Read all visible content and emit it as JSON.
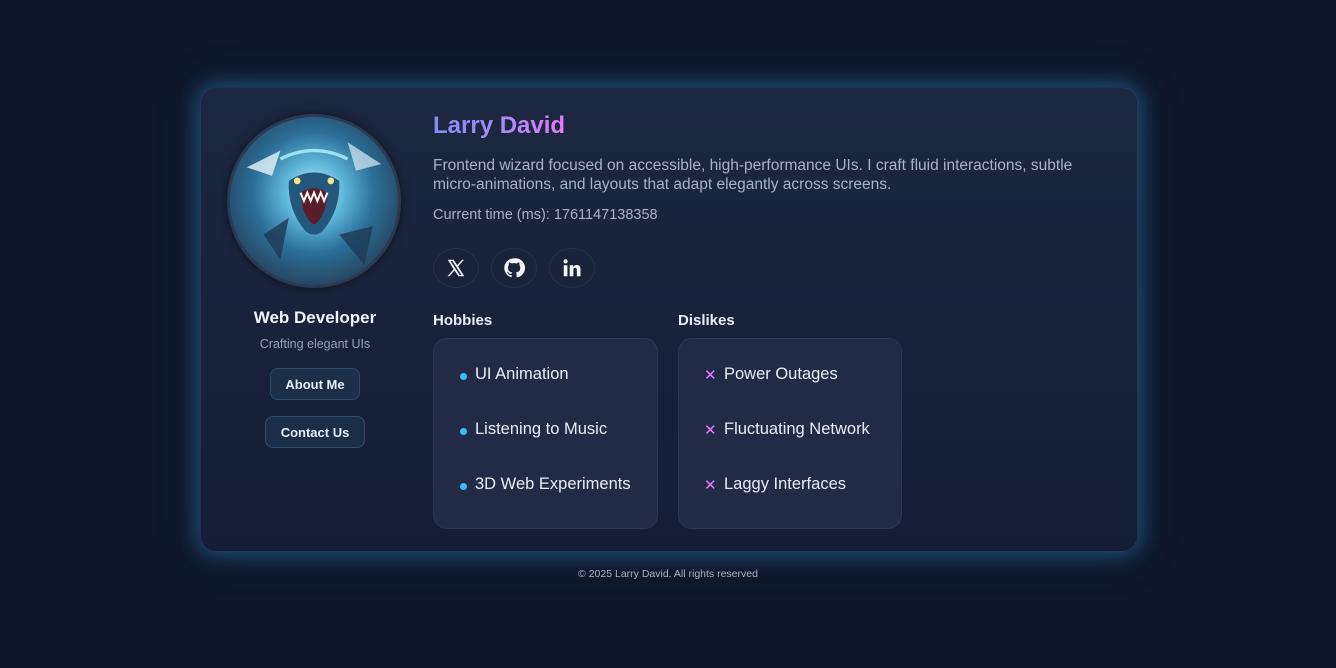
{
  "profile": {
    "name": "Larry David",
    "role": "Web Developer",
    "tagline": "Crafting elegant UIs",
    "bio": "Frontend wizard focused on accessible, high-performance UIs. I craft fluid interactions, subtle micro-animations, and layouts that adapt elegantly across screens.",
    "time_label": "Current time (ms): ",
    "time_value": "1761147138358"
  },
  "buttons": {
    "about": "About Me",
    "contact": "Contact Us"
  },
  "socials": [
    {
      "icon": "x-icon"
    },
    {
      "icon": "github-icon"
    },
    {
      "icon": "linkedin-icon"
    }
  ],
  "hobbies": {
    "title": "Hobbies",
    "items": [
      "UI Animation",
      "Listening to Music",
      "3D Web Experiments"
    ]
  },
  "dislikes": {
    "title": "Dislikes",
    "items": [
      "Power Outages",
      "Fluctuating Network",
      "Laggy Interfaces"
    ]
  },
  "footer": "© 2025 Larry David. All rights reserved",
  "colors": {
    "background": "#0f172a",
    "name_gradient_start": "#818cf8",
    "name_gradient_end": "#e879f9",
    "hobby_dot": "#38bdf8",
    "dislike_mark": "#e879f9"
  }
}
